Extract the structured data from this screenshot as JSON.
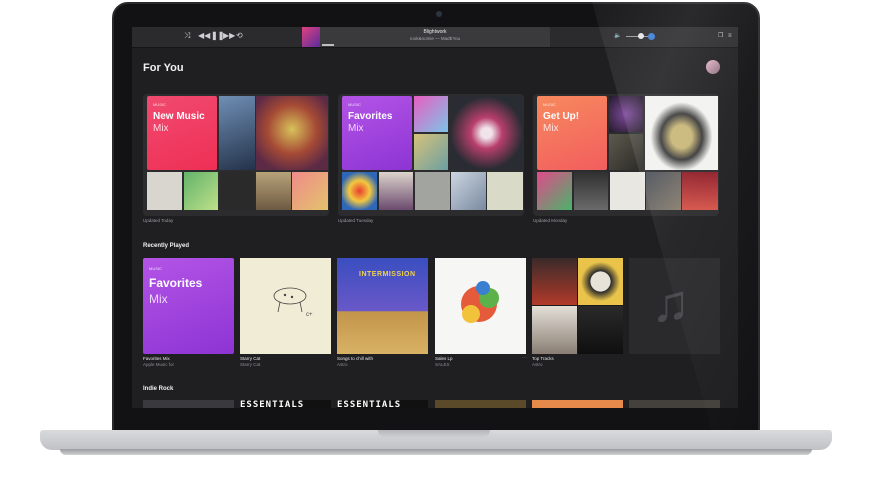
{
  "player": {
    "now_playing_title": "Blightwork",
    "now_playing_subtitle": "rook&nomie — MadEYou",
    "controls": [
      "shuffle",
      "previous",
      "pause",
      "next",
      "repeat"
    ]
  },
  "for_you": {
    "heading": "For You",
    "mixes": [
      {
        "tag": " MUSIC",
        "name": "New Music",
        "sub": "Mix",
        "updated": "Updated Today",
        "color": "#f03b5b"
      },
      {
        "tag": " MUSIC",
        "name": "Favorites",
        "sub": "Mix",
        "updated": "Updated Tuesday",
        "color": "#a145e0"
      },
      {
        "tag": " MUSIC",
        "name": "Get Up!",
        "sub": "Mix",
        "updated": "Updated Monday",
        "color": "#f5735a"
      }
    ]
  },
  "recently_played": {
    "heading": "Recently Played",
    "items": [
      {
        "title": "Favorites Mix",
        "subtitle": "Apple Music for",
        "art_tag": " MUSIC",
        "art_name": "Favorites",
        "art_sub": "Mix"
      },
      {
        "title": "Starry Cat",
        "subtitle": "Starry Cat"
      },
      {
        "title": "Songs to chill with",
        "subtitle": "Astro",
        "art_text": "INTERMISSION"
      },
      {
        "title": "Sales Lp",
        "subtitle": "SALES"
      },
      {
        "title": "Top Tracks",
        "subtitle": "Astro"
      }
    ]
  },
  "indie_rock": {
    "heading": "Indie Rock",
    "banners": [
      "ESSENTIALS",
      "ESSENTIALS"
    ]
  }
}
